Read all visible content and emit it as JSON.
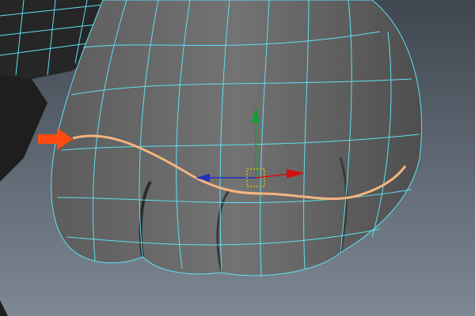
{
  "viewport": {
    "colors": {
      "background_top": "#3f4650",
      "background_bottom": "#7d8893",
      "mesh": "#6b6b6b",
      "mesh_dark": "#222222",
      "wireframe": "#5fe0f0",
      "selected_edge_loop": "#f5b57d",
      "pointer_arrow": "#ff4a10",
      "axis_x": "#d01010",
      "axis_y": "#10a030",
      "axis_z": "#2030c0",
      "pivot": "#f0d000"
    },
    "icons": [
      "move-manipulator-icon",
      "pointer-arrow-icon"
    ]
  }
}
